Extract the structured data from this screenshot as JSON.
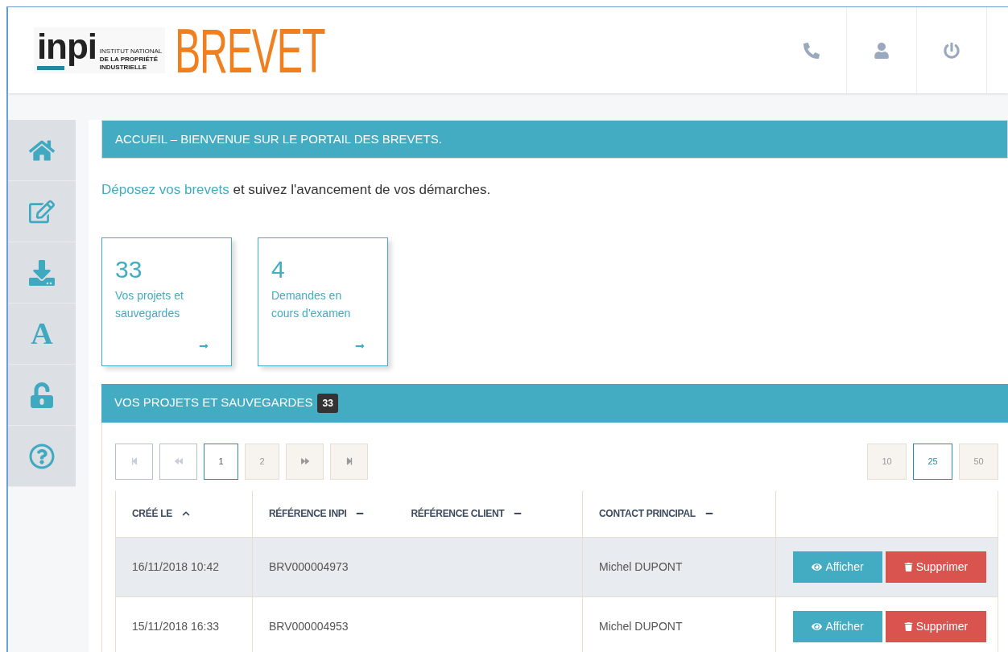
{
  "header": {
    "logo": {
      "mark": "inpi",
      "lines": [
        "INSTITUT NATIONAL",
        "DE LA PROPRIÉTÉ",
        "INDUSTRIELLE"
      ]
    },
    "product": "BREVET",
    "actions": [
      {
        "kind": "phone"
      },
      {
        "kind": "user"
      },
      {
        "kind": "power"
      }
    ]
  },
  "sidebar": {
    "items": [
      {
        "kind": "home"
      },
      {
        "kind": "edit"
      },
      {
        "kind": "download"
      },
      {
        "kind": "text",
        "label": "A"
      },
      {
        "kind": "unlock"
      },
      {
        "kind": "help"
      }
    ]
  },
  "welcome": {
    "title": "ACCUEIL – BIENVENUE SUR LE PORTAIL DES BREVETS.",
    "link": "Déposez vos brevets",
    "text": " et suivez l'avancement de vos démarches."
  },
  "cards": [
    {
      "count": "33",
      "label": "Vos projets et sauvegardes"
    },
    {
      "count": "4",
      "label": "Demandes en cours d'examen"
    }
  ],
  "projects": {
    "title": "VOS PROJETS ET SAUVEGARDES",
    "badge": "33",
    "pager": [
      {
        "kind": "first",
        "disabled": true,
        "selected": false
      },
      {
        "kind": "prev",
        "disabled": true,
        "selected": false
      },
      {
        "kind": "page",
        "label": "1",
        "disabled": false,
        "selected": true
      },
      {
        "kind": "page",
        "label": "2",
        "disabled": false,
        "selected": false
      },
      {
        "kind": "next",
        "disabled": false,
        "selected": false
      },
      {
        "kind": "last",
        "disabled": false,
        "selected": false
      }
    ],
    "page_sizes": [
      {
        "label": "10",
        "selected": false
      },
      {
        "label": "25",
        "selected": true
      },
      {
        "label": "50",
        "selected": false
      }
    ],
    "columns": [
      {
        "label": "CRÉÉ LE",
        "sorted": true
      },
      {
        "label": "RÉFÉRENCE INPI",
        "sorted": false
      },
      {
        "label": "RÉFÉRENCE CLIENT",
        "sorted": false
      },
      {
        "label": "CONTACT PRINCIPAL",
        "sorted": false
      }
    ],
    "rows": [
      {
        "created": "16/11/2018 10:42",
        "ref": "BRV000004973",
        "contact": "Michel DUPONT",
        "selected": true,
        "actions": [
          "Afficher",
          "Supprimer"
        ]
      },
      {
        "created": "15/11/2018 16:33",
        "ref": "BRV000004953",
        "contact": "Michel DUPONT",
        "selected": false,
        "actions": [
          "Afficher",
          "Supprimer"
        ]
      }
    ]
  }
}
